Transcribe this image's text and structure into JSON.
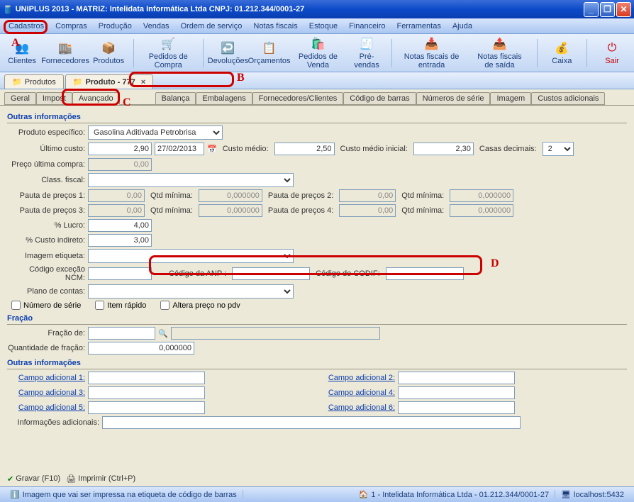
{
  "title": "UNIPLUS  2013 - MATRIZ: Intelidata Informática Ltda CNPJ: 01.212.344/0001-27",
  "menu": [
    "Cadastros",
    "Compras",
    "Produção",
    "Vendas",
    "Ordem de serviço",
    "Notas fiscais",
    "Estoque",
    "Financeiro",
    "Ferramentas",
    "Ajuda"
  ],
  "toolbar": [
    "Clientes",
    "Fornecedores",
    "Produtos",
    "Pedidos de Compra",
    "Devoluções",
    "Orçamentos",
    "Pedidos de Venda",
    "Pré-vendas",
    "Notas fiscais de entrada",
    "Notas fiscais de saída",
    "Caixa",
    "Sair"
  ],
  "doctabs": [
    {
      "label": "Produtos"
    },
    {
      "label": "Produto - 777",
      "active": true
    }
  ],
  "innertabs": [
    "Geral",
    "Impost",
    "Avançado",
    "Balança",
    "Embalagens",
    "Fornecedores/Clientes",
    "Código de barras",
    "Números de série",
    "Imagem",
    "Custos adicionais"
  ],
  "innertab_active": "Avançado",
  "annotations": {
    "A": "A",
    "B": "B",
    "C": "C",
    "D": "D"
  },
  "sections": {
    "outras1": "Outras informações",
    "fracao": "Fração",
    "outras2": "Outras informações"
  },
  "labels": {
    "produto_especifico": "Produto específico:",
    "ultimo_custo": "Último custo:",
    "custo_medio": "Custo médio:",
    "custo_medio_inicial": "Custo médio inicial:",
    "casas_decimais": "Casas decimais:",
    "preco_ultima_compra": "Preço última compra:",
    "class_fiscal": "Class. fiscal:",
    "pauta1": "Pauta de preços 1:",
    "pauta2": "Pauta de preços 2:",
    "pauta3": "Pauta de preços 3:",
    "pauta4": "Pauta de preços 4:",
    "qtd_minima": "Qtd mínima:",
    "pct_lucro": "% Lucro:",
    "pct_custo_indireto": "% Custo indireto:",
    "imagem_etiqueta": "Imagem etiqueta:",
    "codigo_excecao_ncm": "Código exceção NCM:",
    "codigo_anp": "Código da ANP :",
    "codigo_codif": "Código do CODIF:",
    "plano_contas": "Plano de contas:",
    "numero_serie": "Número de série",
    "item_rapido": "Item rápido",
    "altera_preco": "Altera preço no pdv",
    "fracao_de": "Fração de:",
    "quantidade_fracao": "Quantidade de fração:",
    "campo_ad1": "Campo adicional 1:",
    "campo_ad2": "Campo adicional 2:",
    "campo_ad3": "Campo adicional 3:",
    "campo_ad4": "Campo adicional 4:",
    "campo_ad5": "Campo adicional 5:",
    "campo_ad6": "Campo adicional 6:",
    "info_adicionais": "Informações adicionais:"
  },
  "values": {
    "produto_especifico": "Gasolina Aditivada Petrobrisa",
    "ultimo_custo": "2,90",
    "ultimo_custo_data": "27/02/2013",
    "custo_medio": "2,50",
    "custo_medio_inicial": "2,30",
    "casas_decimais": "2",
    "preco_ultima_compra": "0,00",
    "class_fiscal": "",
    "pauta1": "0,00",
    "pauta2": "0,00",
    "pauta3": "0,00",
    "pauta4": "0,00",
    "qtd_min1": "0,000000",
    "qtd_min2": "0,000000",
    "qtd_min3": "0,000000",
    "qtd_min4": "0,000000",
    "pct_lucro": "4,00",
    "pct_custo_indireto": "3,00",
    "imagem_etiqueta": "",
    "codigo_excecao_ncm": "",
    "codigo_anp": "",
    "codigo_codif": "",
    "plano_contas": "",
    "fracao_de": "",
    "fracao_de_desc": "",
    "quantidade_fracao": "0,000000",
    "campo_ad1": "",
    "campo_ad2": "",
    "campo_ad3": "",
    "campo_ad4": "",
    "campo_ad5": "",
    "campo_ad6": "",
    "info_adicionais": ""
  },
  "footer": {
    "gravar": "Gravar (F10)",
    "imprimir": "Imprimir (Ctrl+P)"
  },
  "statusbar": {
    "msg": "Imagem que vai ser impressa na etiqueta de código de barras",
    "empresa": "1 - Intelidata Informática Ltda - 01.212.344/0001-27",
    "host": "localhost:5432"
  }
}
